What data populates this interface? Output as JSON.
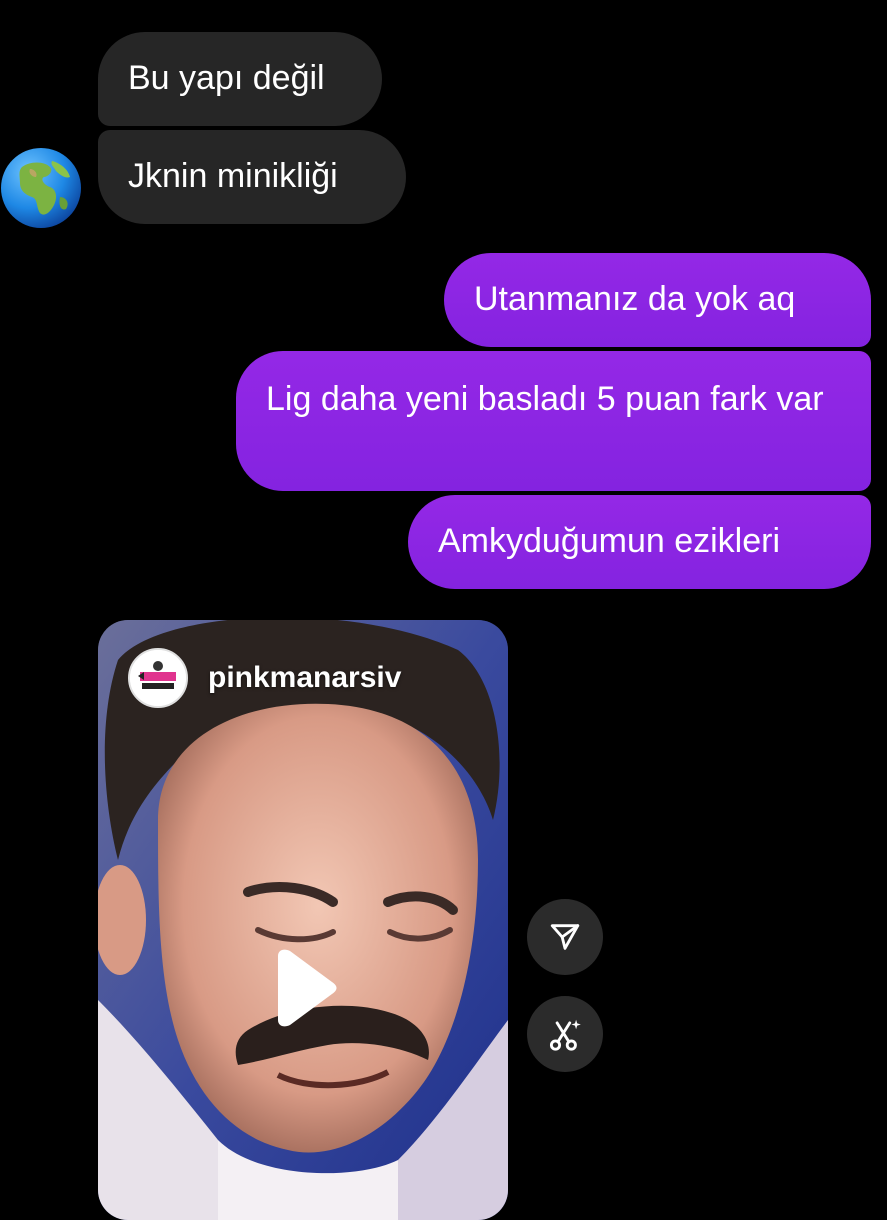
{
  "messages": {
    "incoming": [
      {
        "text": "Bu yapı değil"
      },
      {
        "text": "Jknin minikliği"
      }
    ],
    "outgoing": [
      {
        "text": "Utanmanız da yok aq"
      },
      {
        "text": "Lig daha yeni basladı 5 puan fark var"
      },
      {
        "text": "Amkyduğumun ezikleri"
      }
    ]
  },
  "shared_reel": {
    "username": "pinkmanarsiv"
  },
  "icons": {
    "sender_avatar": "globe-emoji-icon",
    "play": "play-icon",
    "share": "send-icon",
    "remix": "scissors-sparkle-icon"
  },
  "colors": {
    "background": "#000000",
    "incoming_bubble": "#262626",
    "outgoing_bubble": "#8a2be2",
    "text": "#ffffff"
  }
}
